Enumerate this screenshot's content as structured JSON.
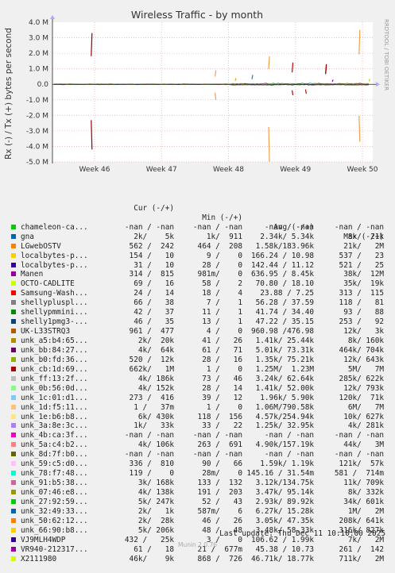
{
  "chart_data": {
    "type": "line",
    "title": "Wireless Traffic - by month",
    "ylabel": "Rx (-) / Tx (+) bytes per second",
    "side_label": "RRDTOOL / TOBI OETIKER",
    "yticks": [
      "4.0 M",
      "3.0 M",
      "2.0 M",
      "1.0 M",
      "0.0",
      "-1.0 M",
      "-2.0 M",
      "-3.0 M",
      "-4.0 M",
      "-5.0 M"
    ],
    "ylim": [
      -5000000,
      4000000
    ],
    "xticks": [
      "Week 46",
      "Week 47",
      "Week 48",
      "Week 49",
      "Week 50"
    ],
    "grid": true,
    "spikes": [
      {
        "week": 45.95,
        "value": 3300000,
        "color": "#990000"
      },
      {
        "week": 45.95,
        "value": -4200000,
        "color": "#990000"
      },
      {
        "week": 47.8,
        "value": 900000,
        "color": "#f0a050"
      },
      {
        "week": 47.8,
        "value": -1000000,
        "color": "#f0a050"
      },
      {
        "week": 48.1,
        "value": 400000,
        "color": "#ff9900"
      },
      {
        "week": 48.35,
        "value": 600000,
        "color": "#1f78b4"
      },
      {
        "week": 48.6,
        "value": -5000000,
        "color": "#f0a050"
      },
      {
        "week": 48.6,
        "value": 1800000,
        "color": "#f0a050"
      },
      {
        "week": 48.95,
        "value": 1400000,
        "color": "#cc0000"
      },
      {
        "week": 48.95,
        "value": -700000,
        "color": "#cc0000"
      },
      {
        "week": 49.15,
        "value": -600000,
        "color": "#cc0000"
      },
      {
        "week": 49.45,
        "value": 1200000,
        "color": "#990000"
      },
      {
        "week": 49.45,
        "value": 1300000,
        "color": "#990000"
      },
      {
        "week": 49.55,
        "value": 300000,
        "color": "#8b00b4"
      },
      {
        "week": 49.95,
        "value": 3500000,
        "color": "#f0a050"
      },
      {
        "week": 49.95,
        "value": -3700000,
        "color": "#f0a050"
      },
      {
        "week": 50.1,
        "value": 350000,
        "color": "#cccc00"
      }
    ]
  },
  "legend": {
    "headers": {
      "cur": "Cur (-/+)",
      "min": "Min (-/+)",
      "avg": "Avg (-/+)",
      "max": "Max (-/+)"
    },
    "rows": [
      {
        "name": "chameleon-ca...",
        "color": "#00cc00",
        "cur": "-nan / -nan",
        "min": "-nan / -nan",
        "avg": "-nan / -nan",
        "max": "-nan / -nan"
      },
      {
        "name": "gna",
        "color": "#0066b3",
        "cur": "2k/    5k",
        "min": "1k/  911",
        "avg": "2.34k/ 5.34k",
        "max": "8k/  21k"
      },
      {
        "name": "LGwebOSTV",
        "color": "#ff8000",
        "cur": "562 /  242",
        "min": "464 /  208",
        "avg": "1.58k/183.96k",
        "max": "21k/   2M"
      },
      {
        "name": "localbytes-p...",
        "color": "#ffcc00",
        "cur": "154 /   10",
        "min": "9 /    0",
        "avg": "166.24 / 10.98",
        "max": "537 /   23"
      },
      {
        "name": "localbytes-p...",
        "color": "#330099",
        "cur": "31 /   10",
        "min": "28 /    0",
        "avg": "142.44 / 11.12",
        "max": "521 /   25"
      },
      {
        "name": "Manen",
        "color": "#990099",
        "cur": "314 /  815",
        "min": "981m/    0",
        "avg": "636.95 / 8.45k",
        "max": "38k/  12M"
      },
      {
        "name": "OCTO-CADLITE",
        "color": "#ccff00",
        "cur": "69 /   16",
        "min": "58 /    2",
        "avg": "70.80 / 18.10",
        "max": "35k/  19k"
      },
      {
        "name": "Samsung-Wash...",
        "color": "#ff0000",
        "cur": "24 /   14",
        "min": "18 /    4",
        "avg": "23.88 / 7.25",
        "max": "313 /  115"
      },
      {
        "name": "shellypluspl...",
        "color": "#808080",
        "cur": "66 /   38",
        "min": "7 /    1",
        "avg": "56.28 / 37.59",
        "max": "118 /   81"
      },
      {
        "name": "shellypmmini...",
        "color": "#008f00",
        "cur": "42 /   37",
        "min": "11 /    1",
        "avg": "41.74 / 34.40",
        "max": "93 /   88"
      },
      {
        "name": "shelly1pmg3-...",
        "color": "#00487d",
        "cur": "46 /   35",
        "min": "13 /    1",
        "avg": "47.22 / 35.15",
        "max": "253 /   92"
      },
      {
        "name": "UK-L33STRQ3",
        "color": "#b35a00",
        "cur": "961 /  477",
        "min": "4 /    0",
        "avg": "960.98 /476.98",
        "max": "12k/   3k"
      },
      {
        "name": "unk_a5:b4:65...",
        "color": "#b38f00",
        "cur": "2k/  20k",
        "min": "41 /   26",
        "avg": "1.41k/ 25.44k",
        "max": "8k/ 160k"
      },
      {
        "name": "unk_bb:84:27...",
        "color": "#6b006b",
        "cur": "4k/  64k",
        "min": "61 /   71",
        "avg": "5.01k/ 73.31k",
        "max": "464k/ 704k"
      },
      {
        "name": "unk_b0:fd:36...",
        "color": "#8fb300",
        "cur": "520 /  12k",
        "min": "28 /   16",
        "avg": "1.35k/ 75.21k",
        "max": "12k/ 643k"
      },
      {
        "name": "unk_cb:1d:69...",
        "color": "#b30000",
        "cur": "662k/   1M",
        "min": "1 /    0",
        "avg": "1.25M/  1.23M",
        "max": "5M/   7M"
      },
      {
        "name": "unk_ff:13:2f...",
        "color": "#bebebe",
        "cur": "4k/ 186k",
        "min": "73 /   46",
        "avg": "3.24k/ 62.64k",
        "max": "285k/ 622k"
      },
      {
        "name": "unk_0b:56:0d...",
        "color": "#80ff80",
        "cur": "4k/ 152k",
        "min": "28 /   14",
        "avg": "1.41k/ 52.00k",
        "max": "12k/ 793k"
      },
      {
        "name": "unk_1c:01:d1...",
        "color": "#80c9ff",
        "cur": "273 /  416",
        "min": "39 /   12",
        "avg": "1.96k/ 5.90k",
        "max": "120k/  71k"
      },
      {
        "name": "unk_1d:f5:11...",
        "color": "#ffc080",
        "cur": "1 /   37m",
        "min": "1 /    0",
        "avg": "1.06M/790.58k",
        "max": "6M/   7M"
      },
      {
        "name": "unk_1e:b6:b8...",
        "color": "#ffe680",
        "cur": "6k/ 430k",
        "min": "118 /  156",
        "avg": "4.57k/254.94k",
        "max": "10k/ 627k"
      },
      {
        "name": "unk_3a:8e:3c...",
        "color": "#aa80ff",
        "cur": "1k/   33k",
        "min": "33 /   22",
        "avg": "1.25k/ 32.95k",
        "max": "4k/ 281k"
      },
      {
        "name": "unk_4b:ca:3f...",
        "color": "#ee00cc",
        "cur": "-nan / -nan",
        "min": "-nan / -nan",
        "avg": "-nan / -nan",
        "max": "-nan / -nan"
      },
      {
        "name": "unk_5a:c4:b2...",
        "color": "#ff8080",
        "cur": "4k/ 106k",
        "min": "263 /  691",
        "avg": "4.90k/157.19k",
        "max": "44k/   3M"
      },
      {
        "name": "unk_8d:7f:b0...",
        "color": "#666600",
        "cur": "-nan / -nan",
        "min": "-nan / -nan",
        "avg": "-nan / -nan",
        "max": "-nan / -nan"
      },
      {
        "name": "unk_59:c5:d0...",
        "color": "#ffbfff",
        "cur": "336 /  810",
        "min": "90 /   66",
        "avg": "1.59k/ 1.19k",
        "max": "121k/  57k"
      },
      {
        "name": "unk_78:f7:48...",
        "color": "#00ffcc",
        "cur": "119 /    0",
        "min": "28m/    0",
        "avg": "145.16 / 31.54m",
        "max": "581 /  714m"
      },
      {
        "name": "unk_91:b5:38...",
        "color": "#cc6699",
        "cur": "3k/ 168k",
        "min": "133 /  132",
        "avg": "3.12k/134.75k",
        "max": "11k/ 709k"
      },
      {
        "name": "unk_07:46:e8...",
        "color": "#999900",
        "cur": "4k/ 138k",
        "min": "191 /  203",
        "avg": "3.47k/ 95.14k",
        "max": "8k/ 332k"
      },
      {
        "name": "unk_27:92:59...",
        "color": "#00cc00",
        "cur": "5k/ 247k",
        "min": "52 /   43",
        "avg": "2.93k/ 89.92k",
        "max": "34k/ 601k"
      },
      {
        "name": "unk_32:49:33...",
        "color": "#0066b3",
        "cur": "2k/   1k",
        "min": "587m/    6",
        "avg": "6.27k/ 15.28k",
        "max": "1M/   2M"
      },
      {
        "name": "unk_50:62:12...",
        "color": "#ff8000",
        "cur": "2k/  28k",
        "min": "46 /   26",
        "avg": "3.05k/ 47.35k",
        "max": "208k/ 641k"
      },
      {
        "name": "unk_66:90:b8...",
        "color": "#ffcc00",
        "cur": "5k/ 206k",
        "min": "48 /   48",
        "avg": "3.48k/ 58.33k",
        "max": "316k/ 827k"
      },
      {
        "name": "VJ9MLH4WDP",
        "color": "#330099",
        "cur": "432 /   25k",
        "min": "3 /    0",
        "avg": "106.62 / 1.99k",
        "max": "7k/   2M"
      },
      {
        "name": "VR940-212317...",
        "color": "#990099",
        "cur": "61 /   18",
        "min": "21 /  677m",
        "avg": "45.38 / 10.73",
        "max": "261 /  142"
      },
      {
        "name": "X2111980",
        "color": "#ccff00",
        "cur": "46k/    9k",
        "min": "868 /  726",
        "avg": "46.71k/ 18.77k",
        "max": "711k/   2M"
      }
    ]
  },
  "footer": {
    "updated": "Last update: Thu Dec 11 10:10:00 2025",
    "munin": "Munin 2.0.76"
  }
}
